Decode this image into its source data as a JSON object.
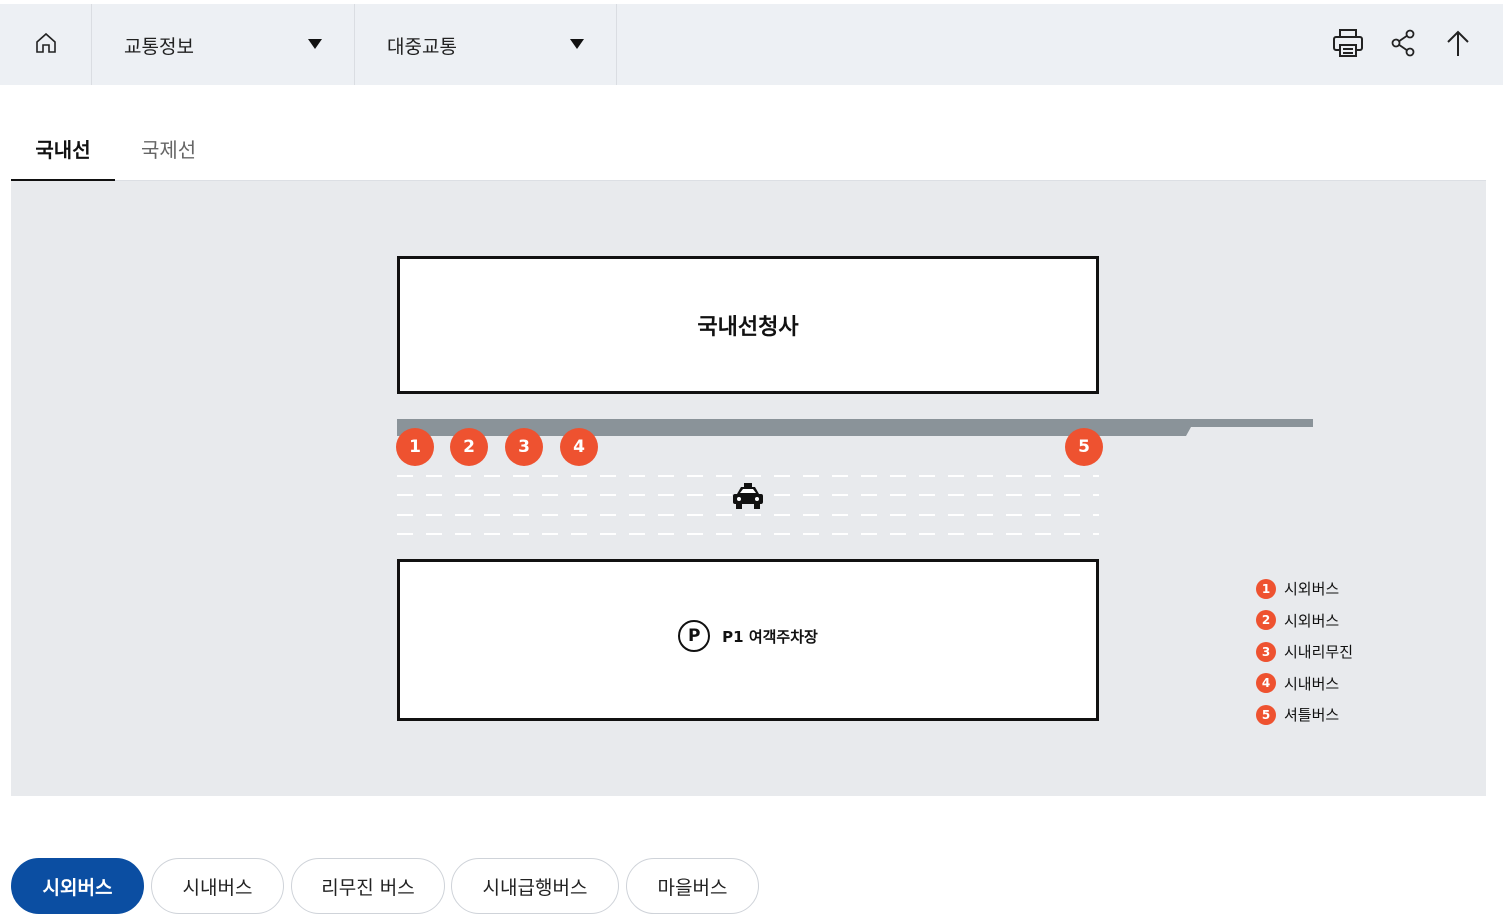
{
  "topbar": {
    "home_icon": "home-icon",
    "dropdown1": "교통정보",
    "dropdown2": "대중교통",
    "tools": [
      "print-icon",
      "share-icon",
      "arrow-up-icon"
    ]
  },
  "tabs": [
    {
      "label": "국내선",
      "active": true
    },
    {
      "label": "국제선",
      "active": false
    }
  ],
  "map": {
    "terminal_label": "국내선청사",
    "parking_symbol": "P",
    "parking_label": "P1 여객주차장",
    "stops": [
      "1",
      "2",
      "3",
      "4",
      "5"
    ],
    "taxi_icon": "taxi-icon",
    "accent_color": "#ee5230",
    "legend": [
      {
        "num": "1",
        "label": "시외버스"
      },
      {
        "num": "2",
        "label": "시외버스"
      },
      {
        "num": "3",
        "label": "시내리무진"
      },
      {
        "num": "4",
        "label": "시내버스"
      },
      {
        "num": "5",
        "label": "셔틀버스"
      }
    ]
  },
  "chips": [
    {
      "label": "시외버스",
      "active": true
    },
    {
      "label": "시내버스",
      "active": false
    },
    {
      "label": "리무진 버스",
      "active": false
    },
    {
      "label": "시내급행버스",
      "active": false
    },
    {
      "label": "마을버스",
      "active": false
    }
  ],
  "colors": {
    "primary": "#0b4ea2",
    "accent": "#ee5230",
    "topbar_bg": "#edf0f4",
    "map_bg": "#e8eaed"
  }
}
